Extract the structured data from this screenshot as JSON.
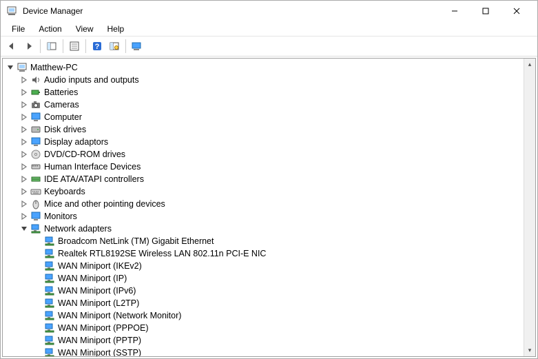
{
  "window": {
    "title": "Device Manager"
  },
  "menu": {
    "items": [
      "File",
      "Action",
      "View",
      "Help"
    ]
  },
  "tree": {
    "root": {
      "label": "Matthew-PC",
      "icon": "computer",
      "expanded": true
    },
    "categories": [
      {
        "label": "Audio inputs and outputs",
        "icon": "audio",
        "expanded": false
      },
      {
        "label": "Batteries",
        "icon": "battery",
        "expanded": false
      },
      {
        "label": "Cameras",
        "icon": "camera",
        "expanded": false
      },
      {
        "label": "Computer",
        "icon": "monitor",
        "expanded": false
      },
      {
        "label": "Disk drives",
        "icon": "disk",
        "expanded": false
      },
      {
        "label": "Display adaptors",
        "icon": "monitor",
        "expanded": false
      },
      {
        "label": "DVD/CD-ROM drives",
        "icon": "disc",
        "expanded": false
      },
      {
        "label": "Human Interface Devices",
        "icon": "hid",
        "expanded": false
      },
      {
        "label": "IDE ATA/ATAPI controllers",
        "icon": "ide",
        "expanded": false
      },
      {
        "label": "Keyboards",
        "icon": "keyboard",
        "expanded": false
      },
      {
        "label": "Mice and other pointing devices",
        "icon": "mouse",
        "expanded": false
      },
      {
        "label": "Monitors",
        "icon": "monitor",
        "expanded": false
      },
      {
        "label": "Network adapters",
        "icon": "network",
        "expanded": true,
        "children": [
          {
            "label": "Broadcom NetLink (TM) Gigabit Ethernet",
            "icon": "network"
          },
          {
            "label": "Realtek RTL8192SE Wireless LAN 802.11n PCI-E NIC",
            "icon": "network"
          },
          {
            "label": "WAN Miniport (IKEv2)",
            "icon": "network"
          },
          {
            "label": "WAN Miniport (IP)",
            "icon": "network"
          },
          {
            "label": "WAN Miniport (IPv6)",
            "icon": "network"
          },
          {
            "label": "WAN Miniport (L2TP)",
            "icon": "network"
          },
          {
            "label": "WAN Miniport (Network Monitor)",
            "icon": "network"
          },
          {
            "label": "WAN Miniport (PPPOE)",
            "icon": "network"
          },
          {
            "label": "WAN Miniport (PPTP)",
            "icon": "network"
          },
          {
            "label": "WAN Miniport (SSTP)",
            "icon": "network"
          }
        ]
      }
    ]
  }
}
